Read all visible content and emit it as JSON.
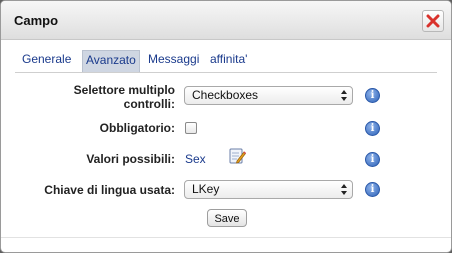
{
  "dialog": {
    "title": "Campo",
    "close_icon": "close-icon"
  },
  "tabs": [
    {
      "label": "Generale",
      "active": false
    },
    {
      "label": "Avanzato",
      "active": true
    },
    {
      "label": "Messaggi",
      "active": false
    },
    {
      "label": "affinita'",
      "active": false
    }
  ],
  "form": {
    "selector": {
      "label_line1": "Selettore multiplo",
      "label_line2": "controlli:",
      "value": "Checkboxes"
    },
    "required": {
      "label": "Obbligatorio:",
      "checked": false
    },
    "values": {
      "label": "Valori possibili:",
      "link": "Sex",
      "edit_icon": "edit-icon"
    },
    "language_key": {
      "label": "Chiave di lingua usata:",
      "value": "LKey"
    },
    "info_glyph": "i",
    "save_label": "Save"
  },
  "colors": {
    "link": "#1a3a8c",
    "close_x": "#d9322c",
    "info": "#2d62b8"
  }
}
